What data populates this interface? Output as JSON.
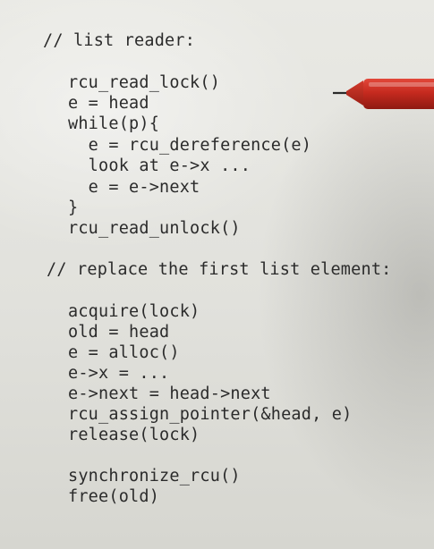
{
  "reader_section": {
    "comment": "// list reader:",
    "lines": [
      "rcu_read_lock()",
      "e = head",
      "while(p){",
      "  e = rcu_dereference(e)",
      "  look at e->x ...",
      "  e = e->next",
      "}",
      "rcu_read_unlock()"
    ]
  },
  "writer_section": {
    "comment": "// replace the first list element:",
    "lines": [
      "acquire(lock)",
      "old = head",
      "e = alloc()",
      "e->x = ...",
      "e->next = head->next",
      "rcu_assign_pointer(&head, e)",
      "release(lock)",
      "",
      "synchronize_rcu()",
      "free(old)"
    ]
  },
  "colors": {
    "ink": "#2b2b2b",
    "pen_body": "#c62a1f",
    "paper": "#e6e6e1"
  },
  "icons": [
    "red-pen-icon"
  ]
}
